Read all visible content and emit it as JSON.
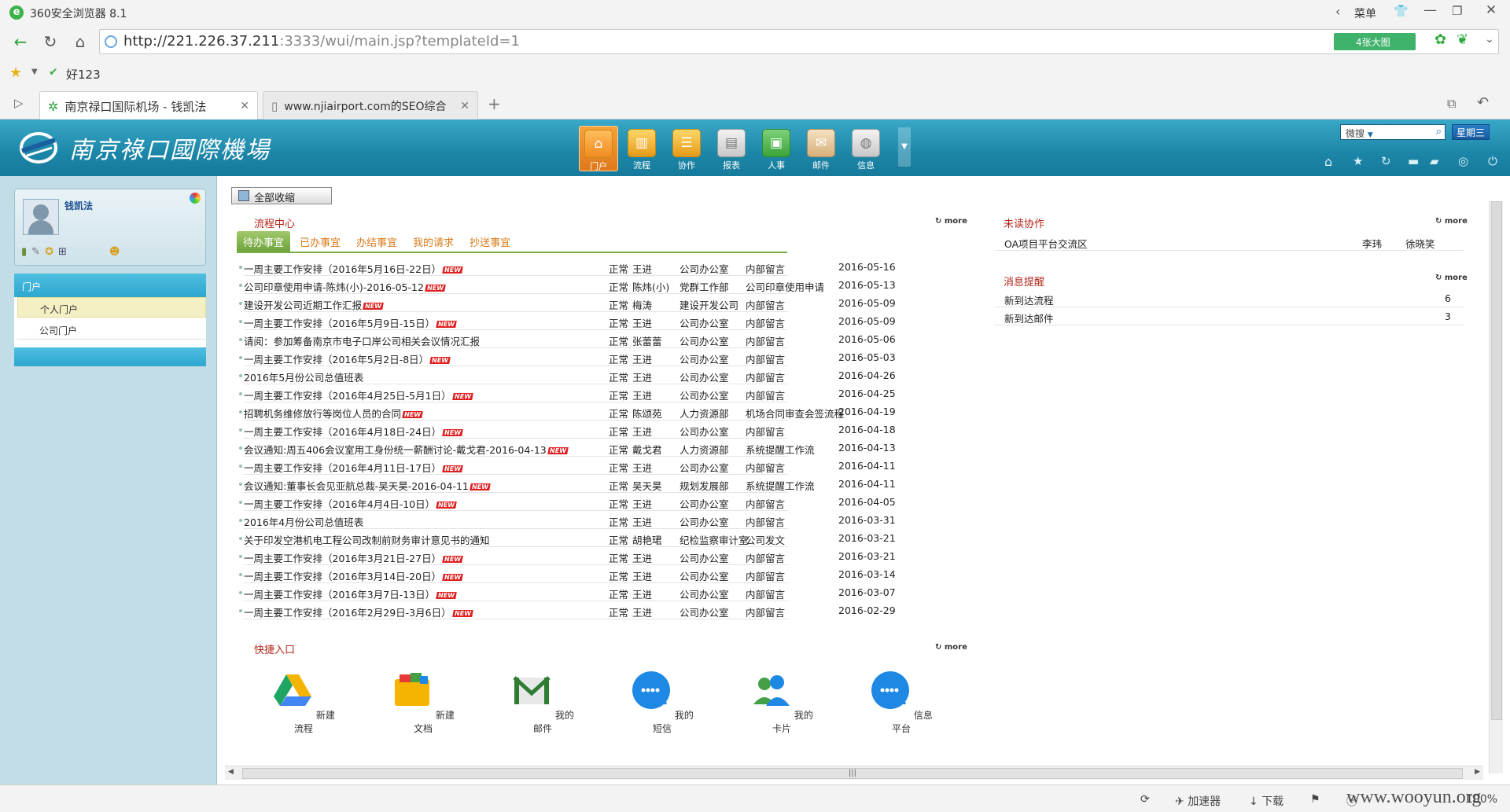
{
  "browser": {
    "title": "360安全浏览器 8.1",
    "menu_label": "菜单",
    "url_host": "http://221.226.37.211",
    "url_rest": ":3333/wui/main.jsp?templateId=1",
    "bigpic_label": "4张大图",
    "fav_label": "好123",
    "tabs": [
      {
        "label": "南京禄口国际机场 - 钱凯法"
      },
      {
        "label": "www.njiairport.com的SEO综合"
      }
    ]
  },
  "app": {
    "logo_text": "南京祿口國際機場",
    "modules": [
      {
        "label": "门户",
        "icon": "home-icon"
      },
      {
        "label": "流程",
        "icon": "chart-icon"
      },
      {
        "label": "协作",
        "icon": "note-icon"
      },
      {
        "label": "报表",
        "icon": "report-icon"
      },
      {
        "label": "人事",
        "icon": "person-icon"
      },
      {
        "label": "邮件",
        "icon": "mail-icon"
      },
      {
        "label": "信息",
        "icon": "globe-icon"
      }
    ],
    "search_label": "微搜",
    "weekday": "星期三"
  },
  "sidebar": {
    "user_name": "钱凯法",
    "section_header": "门户",
    "items": [
      "个人门户",
      "公司门户"
    ]
  },
  "content": {
    "collapse_btn": "全部收缩",
    "more": "more",
    "workflow": {
      "title": "流程中心",
      "tabs": [
        "待办事宜",
        "已办事宜",
        "办结事宜",
        "我的请求",
        "抄送事宜"
      ],
      "rows": [
        {
          "title": "一周主要工作安排（2016年5月16日-22日）",
          "isnew": true,
          "level": "正常",
          "person": "王进",
          "dept": "公司办公室",
          "type": "内部留言",
          "date": "2016-05-16"
        },
        {
          "title": "公司印章使用申请-陈炜(小)-2016-05-12",
          "isnew": true,
          "level": "正常",
          "person": "陈炜(小)",
          "dept": "党群工作部",
          "type": "公司印章使用申请",
          "date": "2016-05-13"
        },
        {
          "title": "建设开发公司近期工作汇报",
          "isnew": true,
          "level": "正常",
          "person": "梅涛",
          "dept": "建设开发公司",
          "type": "内部留言",
          "date": "2016-05-09"
        },
        {
          "title": "一周主要工作安排（2016年5月9日-15日）",
          "isnew": true,
          "level": "正常",
          "person": "王进",
          "dept": "公司办公室",
          "type": "内部留言",
          "date": "2016-05-09"
        },
        {
          "title": "请阅：参加筹备南京市电子口岸公司相关会议情况汇报",
          "isnew": false,
          "level": "正常",
          "person": "张蕾蕾",
          "dept": "公司办公室",
          "type": "内部留言",
          "date": "2016-05-06"
        },
        {
          "title": "一周主要工作安排（2016年5月2日-8日）",
          "isnew": true,
          "level": "正常",
          "person": "王进",
          "dept": "公司办公室",
          "type": "内部留言",
          "date": "2016-05-03"
        },
        {
          "title": "2016年5月份公司总值班表",
          "isnew": false,
          "level": "正常",
          "person": "王进",
          "dept": "公司办公室",
          "type": "内部留言",
          "date": "2016-04-26"
        },
        {
          "title": "一周主要工作安排（2016年4月25日-5月1日）",
          "isnew": true,
          "level": "正常",
          "person": "王进",
          "dept": "公司办公室",
          "type": "内部留言",
          "date": "2016-04-25"
        },
        {
          "title": "招聘机务维修放行等岗位人员的合同",
          "isnew": true,
          "level": "正常",
          "person": "陈颂苑",
          "dept": "人力资源部",
          "type": "机场合同审查会签流程",
          "date": "2016-04-19"
        },
        {
          "title": "一周主要工作安排（2016年4月18日-24日）",
          "isnew": true,
          "level": "正常",
          "person": "王进",
          "dept": "公司办公室",
          "type": "内部留言",
          "date": "2016-04-18"
        },
        {
          "title": "会议通知:周五406会议室用工身份统一薪酬讨论-戴戈君-2016-04-13",
          "isnew": true,
          "level": "正常",
          "person": "戴戈君",
          "dept": "人力资源部",
          "type": "系统提醒工作流",
          "date": "2016-04-13"
        },
        {
          "title": "一周主要工作安排（2016年4月11日-17日）",
          "isnew": true,
          "level": "正常",
          "person": "王进",
          "dept": "公司办公室",
          "type": "内部留言",
          "date": "2016-04-11"
        },
        {
          "title": "会议通知:董事长会见亚航总裁-吴天昊-2016-04-11",
          "isnew": true,
          "level": "正常",
          "person": "吴天昊",
          "dept": "规划发展部",
          "type": "系统提醒工作流",
          "date": "2016-04-11"
        },
        {
          "title": "一周主要工作安排（2016年4月4日-10日）",
          "isnew": true,
          "level": "正常",
          "person": "王进",
          "dept": "公司办公室",
          "type": "内部留言",
          "date": "2016-04-05"
        },
        {
          "title": "2016年4月份公司总值班表",
          "isnew": false,
          "level": "正常",
          "person": "王进",
          "dept": "公司办公室",
          "type": "内部留言",
          "date": "2016-03-31"
        },
        {
          "title": "关于印发空港机电工程公司改制前财务审计意见书的通知",
          "isnew": false,
          "level": "正常",
          "person": "胡艳珺",
          "dept": "纪检监察审计室",
          "type": "公司发文",
          "date": "2016-03-21"
        },
        {
          "title": "一周主要工作安排（2016年3月21日-27日）",
          "isnew": true,
          "level": "正常",
          "person": "王进",
          "dept": "公司办公室",
          "type": "内部留言",
          "date": "2016-03-21"
        },
        {
          "title": "一周主要工作安排（2016年3月14日-20日）",
          "isnew": true,
          "level": "正常",
          "person": "王进",
          "dept": "公司办公室",
          "type": "内部留言",
          "date": "2016-03-14"
        },
        {
          "title": "一周主要工作安排（2016年3月7日-13日）",
          "isnew": true,
          "level": "正常",
          "person": "王进",
          "dept": "公司办公室",
          "type": "内部留言",
          "date": "2016-03-07"
        },
        {
          "title": "一周主要工作安排（2016年2月29日-3月6日）",
          "isnew": true,
          "level": "正常",
          "person": "王进",
          "dept": "公司办公室",
          "type": "内部留言",
          "date": "2016-02-29"
        }
      ]
    },
    "unread": {
      "title": "未读协作",
      "rows": [
        {
          "title": "OA项目平台交流区",
          "a": "李玮",
          "b": "徐晓笑"
        }
      ]
    },
    "messages": {
      "title": "消息提醒",
      "rows": [
        {
          "title": "新到达流程",
          "count": "6"
        },
        {
          "title": "新到达邮件",
          "count": "3"
        }
      ]
    },
    "quick": {
      "title": "快捷入口",
      "items": [
        "新建流程",
        "新建文档",
        "我的邮件",
        "我的短信",
        "我的卡片",
        "信息平台"
      ]
    }
  },
  "statusbar": {
    "accel": "加速器",
    "download": "下载",
    "zoom": "100%",
    "watermark": "www.wooyun.org"
  },
  "new_badge": "NEW"
}
